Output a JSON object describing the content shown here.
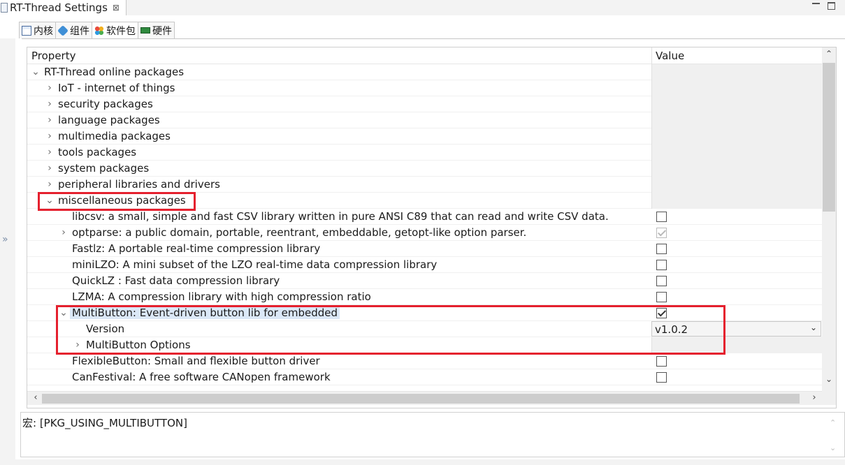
{
  "editor": {
    "title": "RT-Thread Settings",
    "close_glyph": "⊠"
  },
  "tabs": [
    {
      "label": "内核",
      "icon": "kernel-icon"
    },
    {
      "label": "组件",
      "icon": "component-icon"
    },
    {
      "label": "软件包",
      "icon": "package-icon"
    },
    {
      "label": "硬件",
      "icon": "hardware-icon"
    }
  ],
  "tree": {
    "header": {
      "property": "Property",
      "value": "Value"
    },
    "rows": [
      {
        "label": "RT-Thread online packages",
        "expander": "⌄"
      },
      {
        "label": "IoT - internet of things",
        "expander": "›"
      },
      {
        "label": "security packages",
        "expander": "›"
      },
      {
        "label": "language packages",
        "expander": "›"
      },
      {
        "label": "multimedia packages",
        "expander": "›"
      },
      {
        "label": "tools packages",
        "expander": "›"
      },
      {
        "label": "system packages",
        "expander": "›"
      },
      {
        "label": "peripheral libraries and drivers",
        "expander": "›"
      },
      {
        "label": "miscellaneous packages",
        "expander": "⌄"
      },
      {
        "label": "libcsv: a small, simple and fast CSV library written in pure ANSI C89 that can read and write CSV data.",
        "checked": false
      },
      {
        "label": "optparse: a public domain, portable, reentrant, embeddable, getopt-like option parser.",
        "expander": "›",
        "checked": true,
        "disabled": true
      },
      {
        "label": "Fastlz: A portable real-time compression library",
        "checked": false
      },
      {
        "label": "miniLZO: A mini subset of the LZO real-time data compression library",
        "checked": false
      },
      {
        "label": "QuickLZ : Fast data compression library",
        "checked": false
      },
      {
        "label": "LZMA: A compression library with high compression ratio",
        "checked": false
      },
      {
        "label": "MultiButton: Event-driven button lib for embedded",
        "expander": "⌄",
        "checked": true
      },
      {
        "label": "Version",
        "value": "v1.0.2"
      },
      {
        "label": "MultiButton Options",
        "expander": "›"
      },
      {
        "label": "FlexibleButton: Small and flexible button driver",
        "checked": false
      },
      {
        "label": "CanFestival: A free software CANopen framework",
        "checked": false
      }
    ]
  },
  "dropdown_arrow": "⌄",
  "description": {
    "text": "宏: [PKG_USING_MULTIBUTTON]"
  }
}
